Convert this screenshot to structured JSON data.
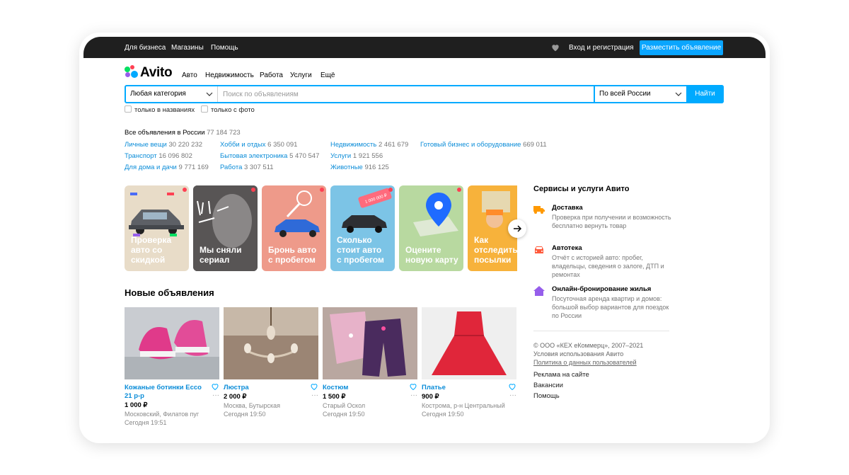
{
  "topbar": {
    "links": [
      "Для бизнеса",
      "Магазины",
      "Помощь"
    ],
    "login": "Вход и регистрация",
    "post_ad": "Разместить объявление"
  },
  "logo": {
    "text": "Avito",
    "colors": [
      "#04e061",
      "#ff4053",
      "#965eeb",
      "#0af"
    ]
  },
  "nav": [
    "Авто",
    "Недвижимость",
    "Работа",
    "Услуги",
    "Ещё"
  ],
  "search": {
    "category": "Любая категория",
    "placeholder": "Поиск по объявлениям",
    "region": "По всей России",
    "button": "Найти",
    "only_titles": "только в названиях",
    "only_photo": "только с фото"
  },
  "all_ads": {
    "label": "Все объявления в России",
    "count": "77 184 723"
  },
  "categories": [
    {
      "name": "Личные вещи",
      "count": "30 220 232"
    },
    {
      "name": "Транспорт",
      "count": "16 096 802"
    },
    {
      "name": "Для дома и дачи",
      "count": "9 771 169"
    },
    {
      "name": "Хобби и отдых",
      "count": "6 350 091"
    },
    {
      "name": "Бытовая электроника",
      "count": "5 470 547"
    },
    {
      "name": "Работа",
      "count": "3 307 511"
    },
    {
      "name": "Недвижимость",
      "count": "2 461 679"
    },
    {
      "name": "Услуги",
      "count": "1 921 556"
    },
    {
      "name": "Животные",
      "count": "916 125"
    },
    {
      "name": "Готовый бизнес и оборудование",
      "count": "669 011"
    }
  ],
  "stories": [
    {
      "line1": "Проверка",
      "line2": "авто со",
      "line3": "скидкой",
      "bg": "#e8dcc8"
    },
    {
      "line1": "Мы сняли",
      "line2": "сериал",
      "line3": "",
      "bg": "#3c3a3a",
      "overlay": "люди за работой"
    },
    {
      "line1": "Бронь авто",
      "line2": "с пробегом",
      "line3": "",
      "bg": "#ee9a8a"
    },
    {
      "line1": "Сколько",
      "line2": "стоит авто",
      "line3": "с пробегом",
      "bg": "#7cc4e6",
      "tag": "1 000 000 ₽"
    },
    {
      "line1": "Оцените",
      "line2": "новую карту",
      "line3": "",
      "bg": "#b8d9a0"
    },
    {
      "line1": "Как",
      "line2": "отследить",
      "line3": "посылки",
      "bg": "#f7b23b"
    }
  ],
  "new_ads_title": "Новые объявления",
  "ads": [
    {
      "title": "Кожаные ботинки Ecco 21 р-р",
      "price": "1 000 ₽",
      "location": "Московский, Филатов пуг",
      "date": "Сегодня 19:51"
    },
    {
      "title": "Люстра",
      "price": "2 000 ₽",
      "location": "Москва, Бутырская",
      "date": "Сегодня 19:50"
    },
    {
      "title": "Костюм",
      "price": "1 500 ₽",
      "location": "Старый Оскол",
      "date": "Сегодня 19:50"
    },
    {
      "title": "Платье",
      "price": "900 ₽",
      "location": "Кострома, р-н Центральный",
      "date": "Сегодня 19:50"
    }
  ],
  "services": {
    "title": "Сервисы и услуги Авито",
    "items": [
      {
        "name": "Доставка",
        "desc": "Проверка при получении и возможность бесплатно вернуть товар",
        "icon": "truck-icon",
        "color": "#ff9900"
      },
      {
        "name": "Автотека",
        "desc": "Отчёт с историей авто: пробег, владельцы, сведения о залоге, ДТП и ремонтах",
        "icon": "car-icon",
        "color": "#ff5a3c"
      },
      {
        "name": "Онлайн-бронирование жилья",
        "desc": "Посуточная аренда квартир и домов: большой выбор вариантов для поездок по России",
        "icon": "house-icon",
        "color": "#965eeb"
      }
    ]
  },
  "footer": {
    "copyright": "© ООО «КЕХ еКоммерц», 2007–2021",
    "terms": "Условия использования Авито",
    "privacy": "Политика о данных пользователей",
    "links": [
      "Реклама на сайте",
      "Вакансии",
      "Помощь"
    ]
  }
}
